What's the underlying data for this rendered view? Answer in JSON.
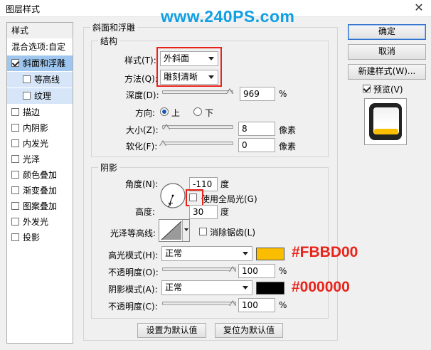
{
  "window": {
    "title": "图层样式",
    "watermark": "www.240PS.com"
  },
  "styles_panel": {
    "items": [
      {
        "label": "样式",
        "kind": "header"
      },
      {
        "label": "混合选项:自定",
        "kind": "header"
      },
      {
        "label": "斜面和浮雕",
        "checked": true,
        "selected": true
      },
      {
        "label": "等高线",
        "checked": false,
        "sub": true
      },
      {
        "label": "纹理",
        "checked": false,
        "sub": true
      },
      {
        "label": "描边",
        "checked": false
      },
      {
        "label": "内阴影",
        "checked": false
      },
      {
        "label": "内发光",
        "checked": false
      },
      {
        "label": "光泽",
        "checked": false
      },
      {
        "label": "颜色叠加",
        "checked": false
      },
      {
        "label": "渐变叠加",
        "checked": false
      },
      {
        "label": "图案叠加",
        "checked": false
      },
      {
        "label": "外发光",
        "checked": false
      },
      {
        "label": "投影",
        "checked": false
      }
    ]
  },
  "bevel": {
    "section_title": "斜面和浮雕",
    "structure_title": "结构",
    "style_label": "样式(T):",
    "style_value": "外斜面",
    "technique_label": "方法(Q):",
    "technique_value": "雕刻清晰",
    "depth_label": "深度(D):",
    "depth_value": "969",
    "depth_unit": "%",
    "depth_fraction": 0.97,
    "direction_label": "方向:",
    "dir_up": "上",
    "dir_down": "下",
    "direction_selected": "上",
    "size_label": "大小(Z):",
    "size_value": "8",
    "size_unit": "像素",
    "size_fraction": 0.04,
    "soften_label": "软化(F):",
    "soften_value": "0",
    "soften_unit": "像素",
    "soften_fraction": 0.0
  },
  "shading": {
    "title": "阴影",
    "angle_label": "角度(N):",
    "angle_value": "-110",
    "angle_unit": "度",
    "global_light_label": "使用全局光(G)",
    "global_light_checked": false,
    "altitude_label": "高度:",
    "altitude_value": "30",
    "altitude_unit": "度",
    "gloss_label": "光泽等高线:",
    "antialias_label": "消除锯齿(L)",
    "antialias_checked": false,
    "highlight_mode_label": "高光模式(H):",
    "highlight_mode_value": "正常",
    "highlight_color": "#FBBD00",
    "highlight_color_text": "#FBBD00",
    "highlight_opacity_label": "不透明度(O):",
    "highlight_opacity_value": "100",
    "highlight_opacity_unit": "%",
    "highlight_opacity_fraction": 1.0,
    "shadow_mode_label": "阴影模式(A):",
    "shadow_mode_value": "正常",
    "shadow_color": "#000000",
    "shadow_color_text": "#000000",
    "shadow_opacity_label": "不透明度(C):",
    "shadow_opacity_value": "100",
    "shadow_opacity_unit": "%",
    "shadow_opacity_fraction": 1.0
  },
  "footer": {
    "make_default": "设置为默认值",
    "reset_default": "复位为默认值"
  },
  "right": {
    "ok": "确定",
    "cancel": "取消",
    "new_style": "新建样式(W)...",
    "preview_label": "预览(V)",
    "preview_checked": true
  }
}
